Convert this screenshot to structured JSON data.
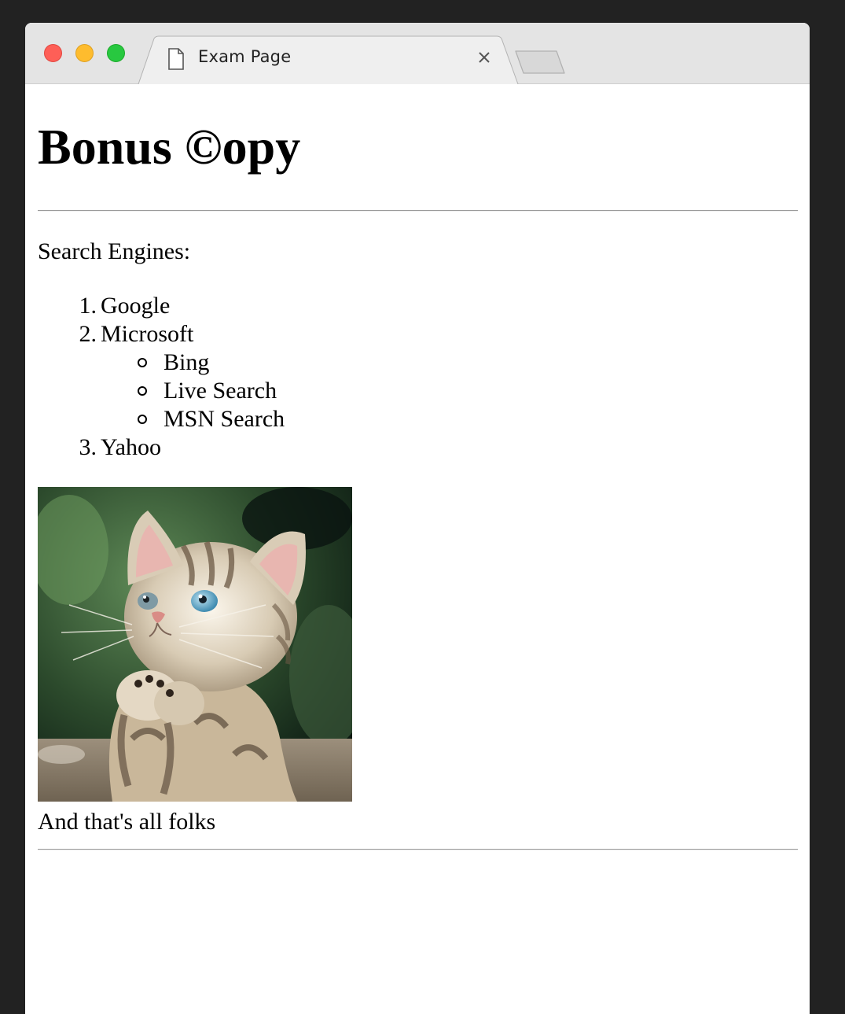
{
  "browser": {
    "tab_title": "Exam Page"
  },
  "page": {
    "heading": "Bonus ©opy",
    "intro": "Search Engines:",
    "engines": [
      {
        "num": "1.",
        "label": "Google",
        "sub": []
      },
      {
        "num": "2.",
        "label": "Microsoft",
        "sub": [
          "Bing",
          "Live Search",
          "MSN Search"
        ]
      },
      {
        "num": "3.",
        "label": "Yahoo",
        "sub": []
      }
    ],
    "image": {
      "subject": "kitten-photo"
    },
    "outro": "And that's all folks"
  }
}
